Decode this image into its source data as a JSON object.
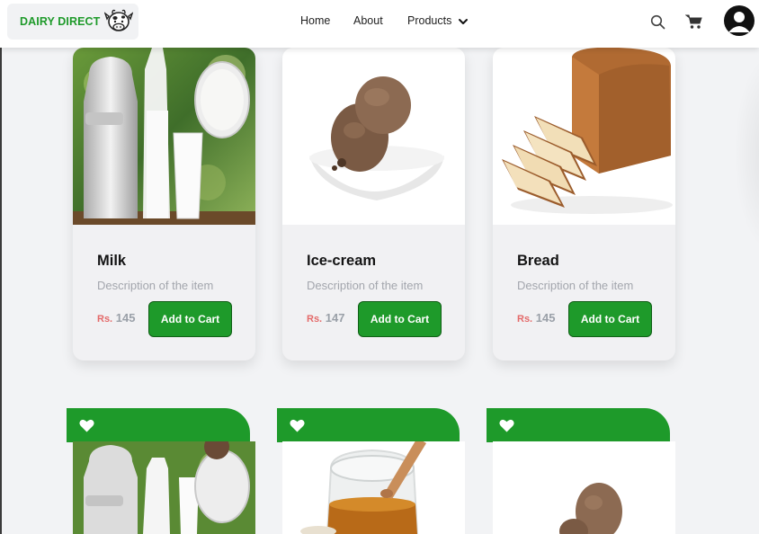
{
  "brand": {
    "name": "DAIRY DIRECT",
    "color": "#1e9a2a"
  },
  "nav": {
    "links": [
      "Home",
      "About",
      "Products"
    ],
    "icons": [
      "search-icon",
      "cart-icon",
      "user-avatar-icon",
      "chevron-down-icon"
    ]
  },
  "products": [
    {
      "title": "Milk",
      "description": "Description of the item",
      "currency": "Rs.",
      "price": "145",
      "button": "Add to Cart"
    },
    {
      "title": "Ice-cream",
      "description": "Description of the item",
      "currency": "Rs.",
      "price": "147",
      "button": "Add to Cart"
    },
    {
      "title": "Bread",
      "description": "Description of the item",
      "currency": "Rs.",
      "price": "145",
      "button": "Add to Cart"
    }
  ],
  "favorites_row": [
    {
      "image": "milk",
      "icon": "heart-icon"
    },
    {
      "image": "honey",
      "icon": "heart-icon"
    },
    {
      "image": "ice-cream",
      "icon": "heart-icon"
    }
  ],
  "colors": {
    "accent": "#1e9a2a",
    "price_currency": "#e46a6a",
    "background": "#f2f3f5"
  }
}
